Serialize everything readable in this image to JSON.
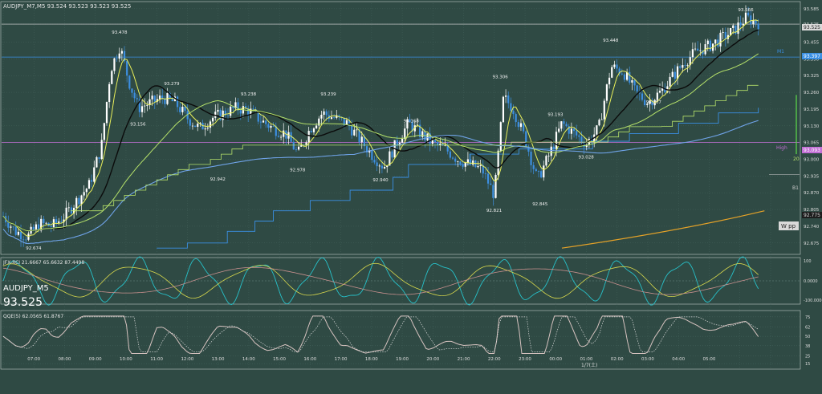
{
  "header": {
    "symbol_info": "AUDJPY_M7,M5  93.524 93.523 93.523 93.525",
    "symbol": "AUDJPY_M5",
    "last_price": "93.525"
  },
  "indicators": {
    "rci_label": "JFX-RCI 21.6667 65.6632 87.4498",
    "qqe_label": "QQE(5) 62.0565 61.8767",
    "level_high": "High",
    "level_20": "20",
    "level_m1": "M1",
    "level_b1": "B1",
    "level_wpp": "W pp"
  },
  "price_tags": {
    "current": "93.525",
    "m1": "93.397",
    "high": "93.093",
    "b1": "92.775"
  },
  "colors": {
    "background": "#2f4a44",
    "up_candle": "#ffffff",
    "down_candle": "#3d8fe0",
    "ma_fast": "#eaf05a",
    "ma_black": "#0b0b0b",
    "ma_lime": "#b6e26a",
    "ma_blue": "#6fa3e8",
    "step_line": "#3a8fe3",
    "orange_line": "#e5a228",
    "purple_line": "#c36fd6",
    "rci_cyan": "#27c1c9",
    "rci_yellow": "#d8d84c",
    "rci_pink": "#c8908e"
  },
  "chart_data": {
    "type": "line",
    "price_axis_ticks": [
      "93.585",
      "93.525",
      "93.455",
      "93.390",
      "93.325",
      "93.260",
      "93.195",
      "93.130",
      "93.065",
      "93.000",
      "92.935",
      "92.870",
      "92.805",
      "92.740",
      "92.675"
    ],
    "rci_ticks": [
      "0.0000",
      "100",
      "-100.0000"
    ],
    "qqe_ticks": [
      "75",
      "62",
      "50",
      "38",
      "25",
      "15"
    ],
    "time_labels": [
      "07:00",
      "08:00",
      "09:00",
      "10:00",
      "11:00",
      "12:00",
      "13:00",
      "14:00",
      "15:00",
      "16:00",
      "17:00",
      "18:00",
      "19:00",
      "20:00",
      "21:00",
      "22:00",
      "23:00",
      "00:00",
      "01:00",
      "02:00",
      "03:00",
      "04:00",
      "05:00"
    ],
    "date_label": "1/7(土)",
    "annotations": [
      {
        "time_index": 3.8,
        "price": 93.478,
        "label": "93.478"
      },
      {
        "time_index": 5.5,
        "price": 93.279,
        "label": "93.279"
      },
      {
        "time_index": 4.4,
        "price": 93.156,
        "label": "93.156"
      },
      {
        "time_index": 8.0,
        "price": 93.238,
        "label": "93.238"
      },
      {
        "time_index": 10.6,
        "price": 93.239,
        "label": "93.239"
      },
      {
        "time_index": 7.0,
        "price": 92.942,
        "label": "92.942"
      },
      {
        "time_index": 9.6,
        "price": 92.978,
        "label": "92.978"
      },
      {
        "time_index": 13.3,
        "price": 93.168,
        "label": "93.168"
      },
      {
        "time_index": 12.3,
        "price": 92.94,
        "label": "92.940"
      },
      {
        "time_index": 16.2,
        "price": 93.306,
        "label": "93.306"
      },
      {
        "time_index": 16.0,
        "price": 92.821,
        "label": "92.821"
      },
      {
        "time_index": 17.5,
        "price": 92.845,
        "label": "92.845"
      },
      {
        "time_index": 18.0,
        "price": 93.193,
        "label": "93.193"
      },
      {
        "time_index": 19.8,
        "price": 93.448,
        "label": "93.448"
      },
      {
        "time_index": 19.0,
        "price": 93.028,
        "label": "93.028"
      },
      {
        "time_index": 21.2,
        "price": 93.207,
        "label": "93.207"
      },
      {
        "time_index": 24.2,
        "price": 93.566,
        "label": "93.566"
      },
      {
        "time_index": 1.0,
        "price": 92.674,
        "label": "92.674"
      }
    ],
    "close_series": [
      {
        "t": 0.0,
        "p": 92.78
      },
      {
        "t": 0.4,
        "p": 92.72
      },
      {
        "t": 0.8,
        "p": 92.7
      },
      {
        "t": 1.2,
        "p": 92.75
      },
      {
        "t": 1.6,
        "p": 92.74
      },
      {
        "t": 2.0,
        "p": 92.78
      },
      {
        "t": 2.4,
        "p": 92.84
      },
      {
        "t": 2.8,
        "p": 92.9
      },
      {
        "t": 3.2,
        "p": 93.05
      },
      {
        "t": 3.5,
        "p": 93.35
      },
      {
        "t": 3.8,
        "p": 93.44
      },
      {
        "t": 4.1,
        "p": 93.3
      },
      {
        "t": 4.4,
        "p": 93.2
      },
      {
        "t": 4.8,
        "p": 93.22
      },
      {
        "t": 5.2,
        "p": 93.24
      },
      {
        "t": 5.6,
        "p": 93.22
      },
      {
        "t": 6.0,
        "p": 93.16
      },
      {
        "t": 6.4,
        "p": 93.12
      },
      {
        "t": 6.8,
        "p": 93.16
      },
      {
        "t": 7.2,
        "p": 93.18
      },
      {
        "t": 7.6,
        "p": 93.2
      },
      {
        "t": 8.0,
        "p": 93.19
      },
      {
        "t": 8.4,
        "p": 93.15
      },
      {
        "t": 8.8,
        "p": 93.12
      },
      {
        "t": 9.2,
        "p": 93.1
      },
      {
        "t": 9.6,
        "p": 93.02
      },
      {
        "t": 10.0,
        "p": 93.12
      },
      {
        "t": 10.4,
        "p": 93.18
      },
      {
        "t": 10.8,
        "p": 93.16
      },
      {
        "t": 11.2,
        "p": 93.14
      },
      {
        "t": 11.6,
        "p": 93.08
      },
      {
        "t": 12.0,
        "p": 93.02
      },
      {
        "t": 12.4,
        "p": 92.97
      },
      {
        "t": 12.8,
        "p": 93.06
      },
      {
        "t": 13.2,
        "p": 93.14
      },
      {
        "t": 13.6,
        "p": 93.1
      },
      {
        "t": 14.0,
        "p": 93.06
      },
      {
        "t": 14.4,
        "p": 93.04
      },
      {
        "t": 14.8,
        "p": 93.0
      },
      {
        "t": 15.2,
        "p": 92.98
      },
      {
        "t": 15.6,
        "p": 92.96
      },
      {
        "t": 16.0,
        "p": 92.86
      },
      {
        "t": 16.3,
        "p": 93.24
      },
      {
        "t": 16.6,
        "p": 93.2
      },
      {
        "t": 17.0,
        "p": 93.08
      },
      {
        "t": 17.4,
        "p": 92.92
      },
      {
        "t": 17.8,
        "p": 93.02
      },
      {
        "t": 18.2,
        "p": 93.14
      },
      {
        "t": 18.6,
        "p": 93.1
      },
      {
        "t": 19.0,
        "p": 93.06
      },
      {
        "t": 19.4,
        "p": 93.12
      },
      {
        "t": 19.8,
        "p": 93.36
      },
      {
        "t": 20.2,
        "p": 93.34
      },
      {
        "t": 20.6,
        "p": 93.26
      },
      {
        "t": 21.0,
        "p": 93.22
      },
      {
        "t": 21.4,
        "p": 93.26
      },
      {
        "t": 21.8,
        "p": 93.32
      },
      {
        "t": 22.2,
        "p": 93.38
      },
      {
        "t": 22.6,
        "p": 93.42
      },
      {
        "t": 23.0,
        "p": 93.44
      },
      {
        "t": 23.4,
        "p": 93.47
      },
      {
        "t": 23.8,
        "p": 93.5
      },
      {
        "t": 24.2,
        "p": 93.55
      },
      {
        "t": 24.6,
        "p": 93.53
      }
    ]
  }
}
